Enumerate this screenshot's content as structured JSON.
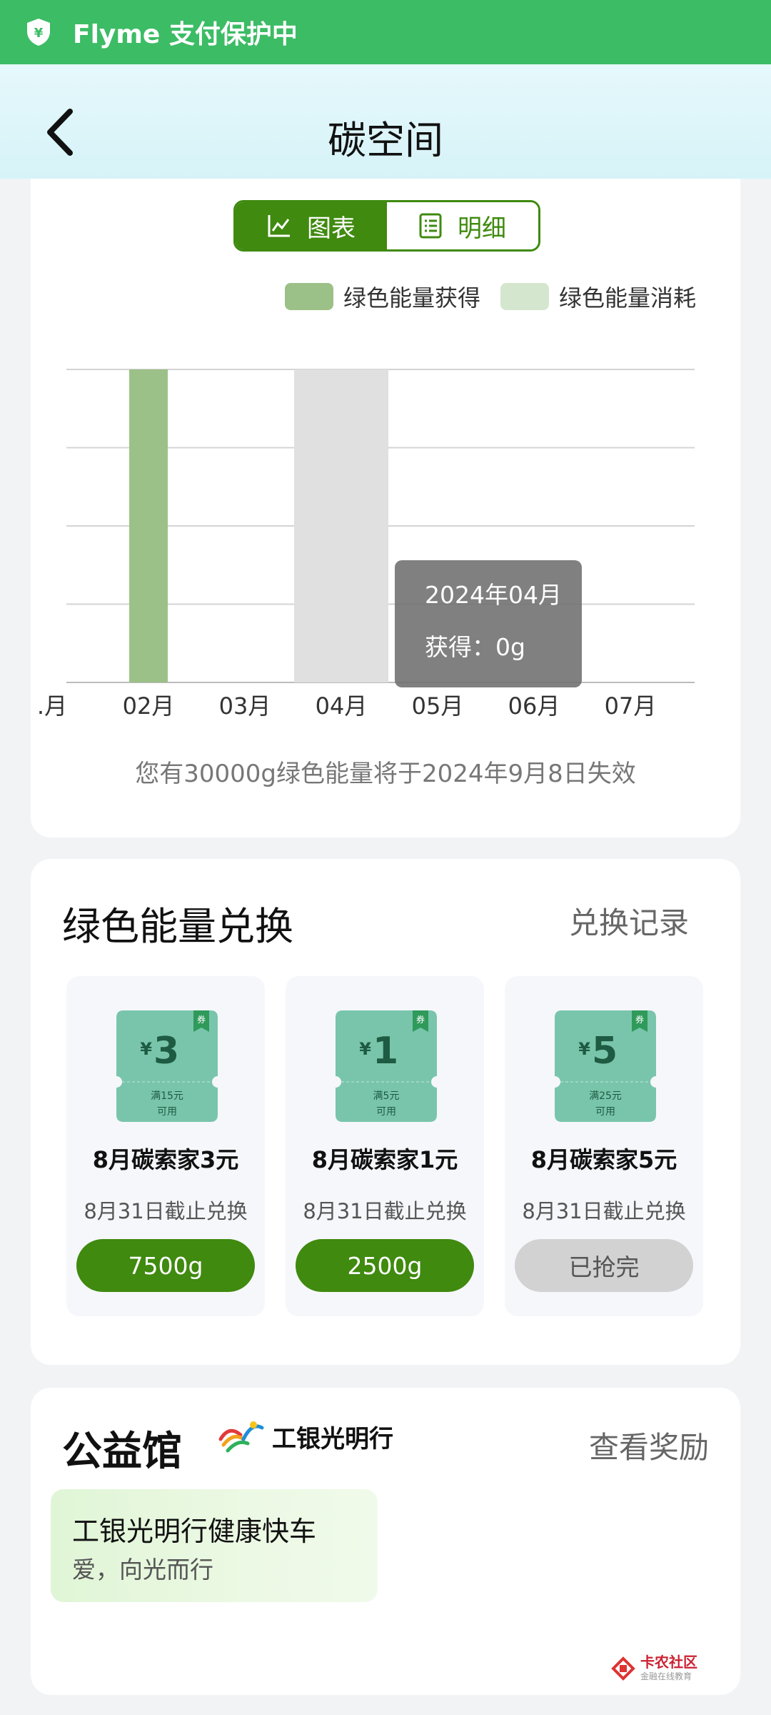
{
  "status_bar": {
    "text": "Flyme 支付保护中",
    "color": "#3cbc65"
  },
  "header": {
    "title": "碳空间"
  },
  "chart_section": {
    "tabs": [
      {
        "label": "图表",
        "icon": "line-chart-icon",
        "active": true
      },
      {
        "label": "明细",
        "icon": "list-icon",
        "active": false
      }
    ],
    "tooltip": {
      "line1": "2024年04月",
      "line2": "获得：0g"
    },
    "expire_text": "您有30000g绿色能量将于2024年9月8日失效"
  },
  "chart_data": {
    "type": "bar",
    "categories": [
      ".月",
      "02月",
      "03月",
      "04月",
      "05月",
      "06月",
      "07月"
    ],
    "series": [
      {
        "name": "绿色能量获得",
        "color": "#9cc188",
        "values": [
          0,
          4,
          0,
          0,
          0,
          0,
          0
        ]
      },
      {
        "name": "绿色能量消耗",
        "color": "#d5e6ce",
        "values": [
          0,
          0,
          0,
          0,
          0,
          0,
          0
        ]
      }
    ],
    "highlight": {
      "category": "04月",
      "color": "#e0e0e0"
    },
    "ylim": [
      0,
      4
    ],
    "grid": true,
    "legend": "top-right",
    "xlabel": "",
    "ylabel": "",
    "title": ""
  },
  "exchange": {
    "title": "绿色能量兑换",
    "record_link": "兑换记录",
    "coupon_tag": "券",
    "coupons": [
      {
        "amount": "3",
        "currency": "¥",
        "condition": "满15元",
        "usable": "可用",
        "name": "8月碳索家3元",
        "deadline": "8月31日截止兑换",
        "button": "7500g",
        "available": true
      },
      {
        "amount": "1",
        "currency": "¥",
        "condition": "满5元",
        "usable": "可用",
        "name": "8月碳索家1元",
        "deadline": "8月31日截止兑换",
        "button": "2500g",
        "available": true
      },
      {
        "amount": "5",
        "currency": "¥",
        "condition": "满25元",
        "usable": "可用",
        "name": "8月碳索家5元",
        "deadline": "8月31日截止兑换",
        "button": "已抢完",
        "available": false
      }
    ]
  },
  "charity": {
    "title": "公益馆",
    "logo_text": "工银光明行",
    "reward_link": "查看奖励",
    "card": {
      "title": "工银光明行健康快车",
      "subtitle": "爱，向光而行"
    }
  },
  "watermark": {
    "line1": "卡农社区",
    "line2": "金融在线教育"
  },
  "colors": {
    "accent": "#3f8a0f",
    "bar_gain": "#9cc188",
    "bar_cost": "#d5e6ce"
  }
}
